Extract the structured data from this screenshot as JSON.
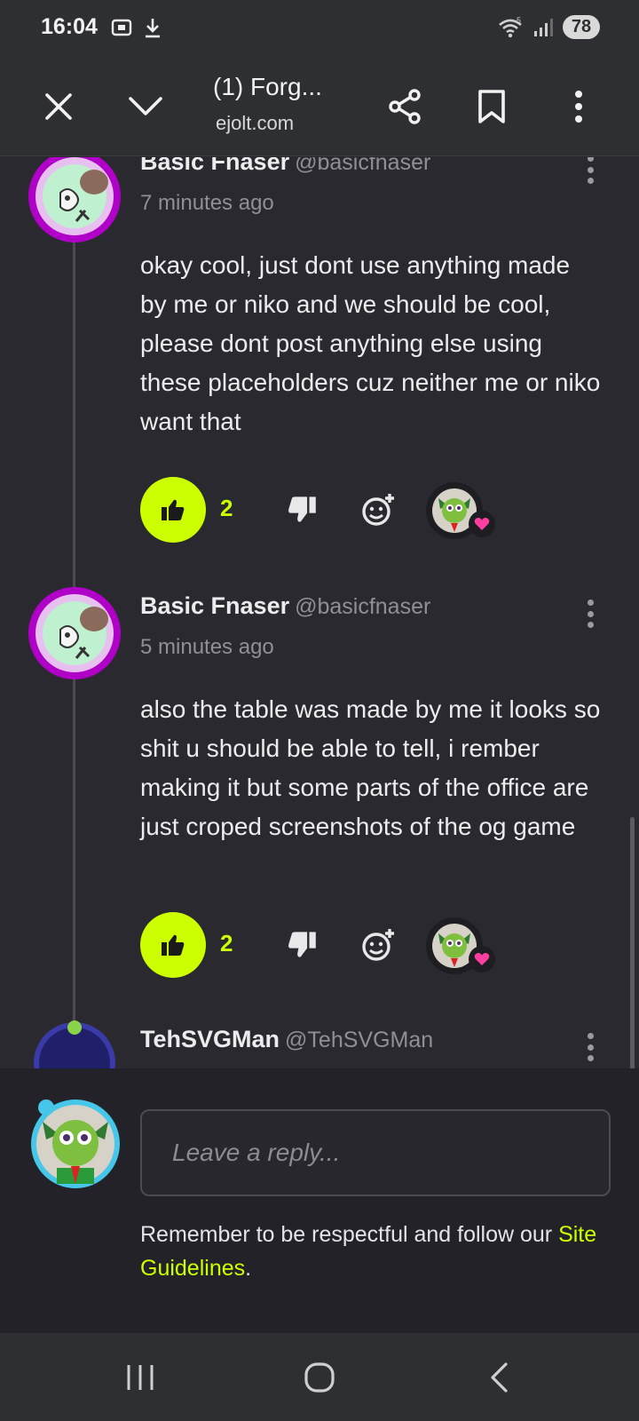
{
  "status": {
    "time": "16:04",
    "battery": "78",
    "wifi_label": "5"
  },
  "toolbar": {
    "title": "(1) Forg...",
    "url": "ejolt.com"
  },
  "comments": [
    {
      "author": "Basic Fnaser",
      "handle": "@basicfnaser",
      "time": "7 minutes ago",
      "text": "okay cool, just dont use anything made by me or niko and we should be cool, please dont post anything else using these placeholders cuz neither me or niko want that",
      "likes": "2"
    },
    {
      "author": "Basic Fnaser",
      "handle": "@basicfnaser",
      "time": "5 minutes ago",
      "text": "also the table was made by me it looks so shit u should be able to tell, i rember making it but some parts of the office are just croped screenshots of the og game",
      "likes": "2"
    },
    {
      "author": "TehSVGMan",
      "handle": "@TehSVGMan"
    }
  ],
  "reply": {
    "placeholder": "Leave a reply...",
    "notice": "Remember to be respectful and follow our ",
    "link": "Site Guidelines",
    "notice_end": "."
  },
  "colors": {
    "accent": "#ccff00",
    "background": "#2a2930",
    "heart": "#ff3fa0"
  }
}
